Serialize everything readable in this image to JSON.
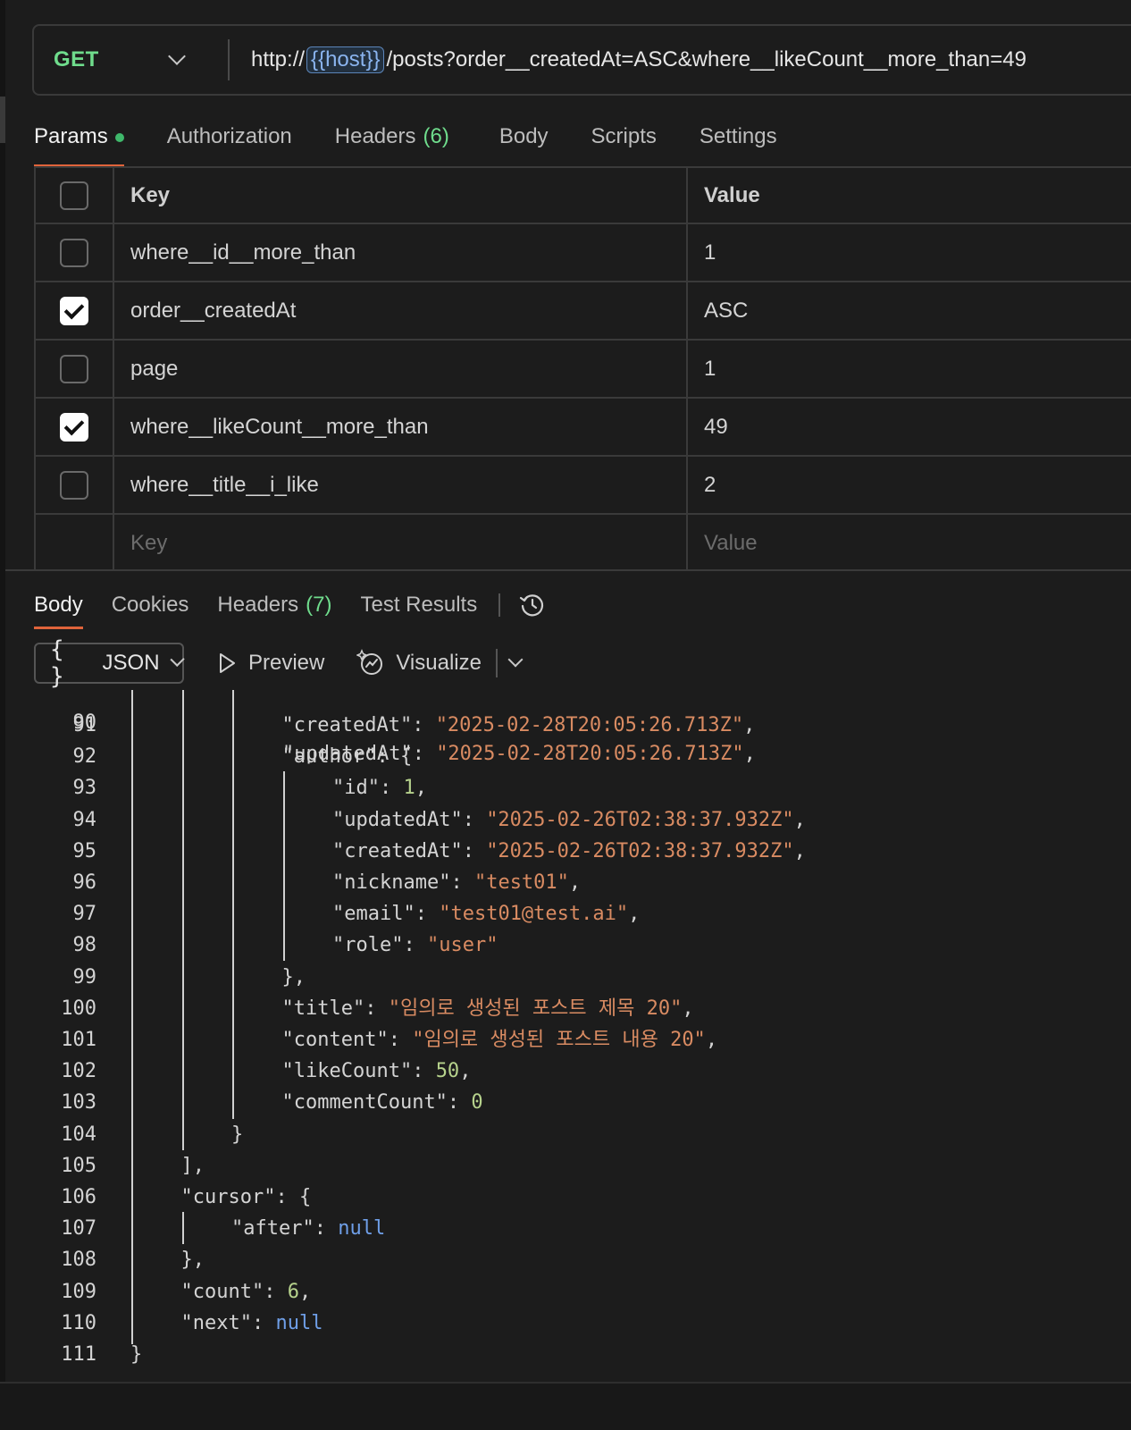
{
  "request": {
    "method": "GET",
    "url_prefix": "http://",
    "url_variable": "{{host}}",
    "url_suffix": "/posts?order__createdAt=ASC&where__likeCount__more_than=49"
  },
  "request_tabs": {
    "params": "Params",
    "authorization": "Authorization",
    "headers": "Headers",
    "headers_count": "(6)",
    "body": "Body",
    "scripts": "Scripts",
    "settings": "Settings"
  },
  "params_table": {
    "key_header": "Key",
    "value_header": "Value",
    "rows": [
      {
        "checked": false,
        "key": "where__id__more_than",
        "value": "1"
      },
      {
        "checked": true,
        "key": "order__createdAt",
        "value": "ASC"
      },
      {
        "checked": false,
        "key": "page",
        "value": "1"
      },
      {
        "checked": true,
        "key": "where__likeCount__more_than",
        "value": "49"
      },
      {
        "checked": false,
        "key": "where__title__i_like",
        "value": "2"
      }
    ],
    "key_placeholder": "Key",
    "value_placeholder": "Value"
  },
  "response_tabs": {
    "body": "Body",
    "cookies": "Cookies",
    "headers": "Headers",
    "headers_count": "(7)",
    "test_results": "Test Results",
    "history_icon": "history-icon"
  },
  "response_toolbar": {
    "format_braces": "{ }",
    "format": "JSON",
    "preview": "Preview",
    "visualize": "Visualize"
  },
  "code_lines": [
    {
      "n": "91",
      "ind": 3,
      "parts": [
        [
          "p",
          "\"createdAt\": "
        ],
        [
          "s",
          "\"2025-02-28T20:05:26.713Z\""
        ],
        [
          "p",
          ","
        ]
      ]
    },
    {
      "n": "92",
      "ind": 3,
      "parts": [
        [
          "p",
          "\"author\": {"
        ]
      ]
    },
    {
      "n": "93",
      "ind": 4,
      "parts": [
        [
          "p",
          "\"id\": "
        ],
        [
          "n",
          "1"
        ],
        [
          "p",
          ","
        ]
      ]
    },
    {
      "n": "94",
      "ind": 4,
      "parts": [
        [
          "p",
          "\"updatedAt\": "
        ],
        [
          "s",
          "\"2025-02-26T02:38:37.932Z\""
        ],
        [
          "p",
          ","
        ]
      ]
    },
    {
      "n": "95",
      "ind": 4,
      "parts": [
        [
          "p",
          "\"createdAt\": "
        ],
        [
          "s",
          "\"2025-02-26T02:38:37.932Z\""
        ],
        [
          "p",
          ","
        ]
      ]
    },
    {
      "n": "96",
      "ind": 4,
      "parts": [
        [
          "p",
          "\"nickname\": "
        ],
        [
          "s",
          "\"test01\""
        ],
        [
          "p",
          ","
        ]
      ]
    },
    {
      "n": "97",
      "ind": 4,
      "parts": [
        [
          "p",
          "\"email\": "
        ],
        [
          "s",
          "\"test01@test.ai\""
        ],
        [
          "p",
          ","
        ]
      ]
    },
    {
      "n": "98",
      "ind": 4,
      "parts": [
        [
          "p",
          "\"role\": "
        ],
        [
          "s",
          "\"user\""
        ]
      ]
    },
    {
      "n": "99",
      "ind": 3,
      "parts": [
        [
          "p",
          "},"
        ]
      ]
    },
    {
      "n": "100",
      "ind": 3,
      "parts": [
        [
          "p",
          "\"title\": "
        ],
        [
          "s",
          "\"임의로 생성된 포스트 제목 20\""
        ],
        [
          "p",
          ","
        ]
      ]
    },
    {
      "n": "101",
      "ind": 3,
      "parts": [
        [
          "p",
          "\"content\": "
        ],
        [
          "s",
          "\"임의로 생성된 포스트 내용 20\""
        ],
        [
          "p",
          ","
        ]
      ]
    },
    {
      "n": "102",
      "ind": 3,
      "parts": [
        [
          "p",
          "\"likeCount\": "
        ],
        [
          "n",
          "50"
        ],
        [
          "p",
          ","
        ]
      ]
    },
    {
      "n": "103",
      "ind": 3,
      "parts": [
        [
          "p",
          "\"commentCount\": "
        ],
        [
          "n",
          "0"
        ]
      ]
    },
    {
      "n": "104",
      "ind": 2,
      "parts": [
        [
          "p",
          "}"
        ]
      ]
    },
    {
      "n": "105",
      "ind": 1,
      "parts": [
        [
          "p",
          "],"
        ]
      ]
    },
    {
      "n": "106",
      "ind": 1,
      "parts": [
        [
          "p",
          "\"cursor\": {"
        ]
      ]
    },
    {
      "n": "107",
      "ind": 2,
      "parts": [
        [
          "p",
          "\"after\": "
        ],
        [
          "k",
          "null"
        ]
      ]
    },
    {
      "n": "108",
      "ind": 1,
      "parts": [
        [
          "p",
          "},"
        ]
      ]
    },
    {
      "n": "109",
      "ind": 1,
      "parts": [
        [
          "p",
          "\"count\": "
        ],
        [
          "n",
          "6"
        ],
        [
          "p",
          ","
        ]
      ]
    },
    {
      "n": "110",
      "ind": 1,
      "parts": [
        [
          "p",
          "\"next\": "
        ],
        [
          "k",
          "null"
        ]
      ]
    },
    {
      "n": "111",
      "ind": 0,
      "parts": [
        [
          "p",
          "}"
        ]
      ]
    }
  ]
}
